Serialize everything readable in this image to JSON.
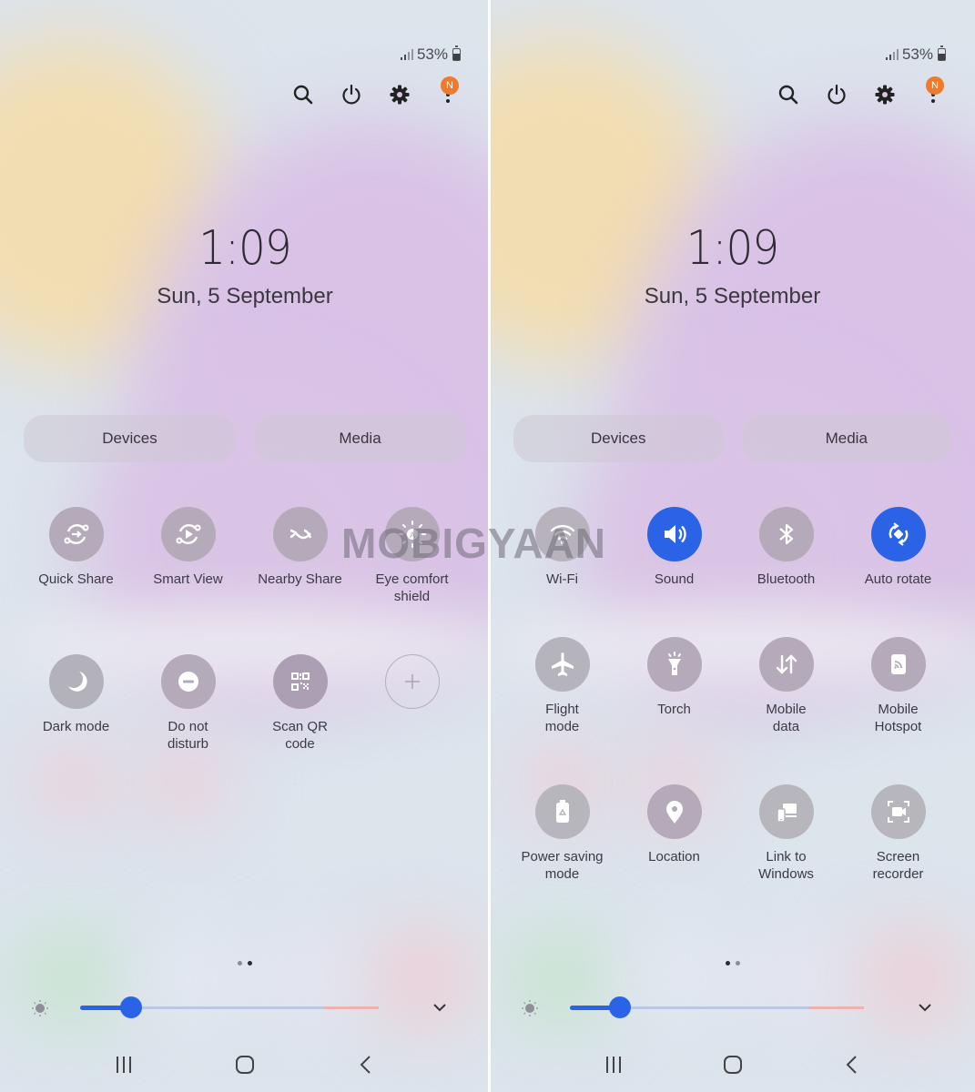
{
  "watermark": "MOBIGYAAN",
  "panels": [
    {
      "id": "left",
      "status": {
        "battery_text": "53%"
      },
      "top_actions": [
        "search",
        "power",
        "settings",
        "more-options"
      ],
      "notification_badge": "N",
      "clock": {
        "time": "1:09",
        "date": "Sun, 5 September"
      },
      "pills": {
        "devices": "Devices",
        "media": "Media"
      },
      "tiles": [
        {
          "label": "Quick Share",
          "icon": "quick-share-icon",
          "state": "off"
        },
        {
          "label": "Smart View",
          "icon": "smart-view-icon",
          "state": "off"
        },
        {
          "label": "Nearby Share",
          "icon": "nearby-share-icon",
          "state": "off"
        },
        {
          "label": "Eye comfort\nshield",
          "icon": "eye-comfort-icon",
          "state": "off"
        },
        {
          "label": "Dark mode",
          "icon": "moon-icon",
          "state": "off"
        },
        {
          "label": "Do not\ndisturb",
          "icon": "do-not-disturb-icon",
          "state": "off"
        },
        {
          "label": "Scan QR\ncode",
          "icon": "qr-code-icon",
          "state": "off"
        },
        {
          "label": "",
          "icon": "add-icon",
          "state": "add"
        }
      ],
      "page_indicator": {
        "pages": 2,
        "active": 2
      },
      "brightness": {
        "level_percent": 17
      }
    },
    {
      "id": "right",
      "status": {
        "battery_text": "53%"
      },
      "top_actions": [
        "search",
        "power",
        "settings",
        "more-options"
      ],
      "notification_badge": "N",
      "clock": {
        "time": "1:09",
        "date": "Sun, 5 September"
      },
      "pills": {
        "devices": "Devices",
        "media": "Media"
      },
      "tiles": [
        {
          "label": "Wi-Fi",
          "icon": "wifi-icon",
          "state": "off"
        },
        {
          "label": "Sound",
          "icon": "sound-icon",
          "state": "on"
        },
        {
          "label": "Bluetooth",
          "icon": "bluetooth-icon",
          "state": "off"
        },
        {
          "label": "Auto rotate",
          "icon": "auto-rotate-icon",
          "state": "on"
        },
        {
          "label": "Flight\nmode",
          "icon": "airplane-icon",
          "state": "off"
        },
        {
          "label": "Torch",
          "icon": "torch-icon",
          "state": "off"
        },
        {
          "label": "Mobile\ndata",
          "icon": "mobile-data-icon",
          "state": "off"
        },
        {
          "label": "Mobile\nHotspot",
          "icon": "hotspot-icon",
          "state": "off"
        },
        {
          "label": "Power saving\nmode",
          "icon": "power-saving-icon",
          "state": "off"
        },
        {
          "label": "Location",
          "icon": "location-icon",
          "state": "off"
        },
        {
          "label": "Link to\nWindows",
          "icon": "link-to-windows-icon",
          "state": "off"
        },
        {
          "label": "Screen\nrecorder",
          "icon": "screen-recorder-icon",
          "state": "off"
        }
      ],
      "page_indicator": {
        "pages": 2,
        "active": 1
      },
      "brightness": {
        "level_percent": 17
      }
    }
  ],
  "colors": {
    "accent_blue": "#2a63e6",
    "tile_off": "#b4aab9",
    "badge_orange": "#ef7a2c",
    "text_dark": "#3c3a44"
  }
}
